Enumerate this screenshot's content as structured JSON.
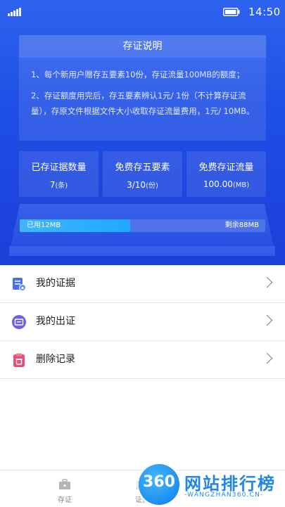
{
  "status": {
    "time": "14:50"
  },
  "notice": {
    "title": "存证说明",
    "p1": "1、每个新用户赠存五要素10份，存证流量100MB的额度；",
    "p2": "2、存证额度用完后，存五要素辨认1元/ 1份（不计算存证流量），存原文件根据文件大小收取存证流量费用，1元/ 10MB。"
  },
  "stats": [
    {
      "label": "已存证据数量",
      "value": "7",
      "unit": "(条)"
    },
    {
      "label": "免费存五要素",
      "value": "3/10",
      "unit": "(份)"
    },
    {
      "label": "免费存证流量",
      "value": "100.00",
      "unit": "(MB)"
    }
  ],
  "storage": {
    "used_label": "已用12MB",
    "remaining_label": "剩余88MB",
    "used_fraction": 0.45
  },
  "menu": [
    {
      "label": "我的证据",
      "icon": "evidence-icon"
    },
    {
      "label": "我的出证",
      "icon": "certificate-icon"
    },
    {
      "label": "删除记录",
      "icon": "delete-record-icon"
    }
  ],
  "tabs": [
    {
      "label": "存证",
      "icon": "briefcase-icon"
    },
    {
      "label": "证据",
      "icon": "folder-icon"
    }
  ],
  "watermark": {
    "logo": "360",
    "title": "网站排行榜",
    "subtitle": "-WANGZHAN360.CN-"
  },
  "colors": {
    "primary": "#1f4fe6",
    "accent": "#1fa8ff"
  }
}
